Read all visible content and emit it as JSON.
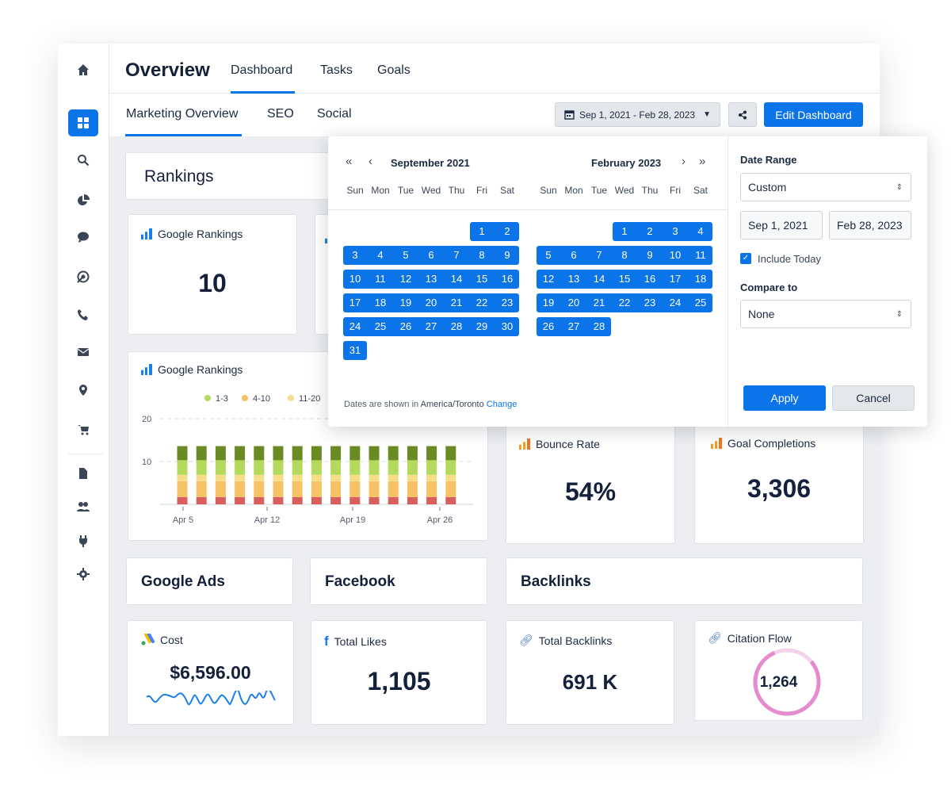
{
  "colors": {
    "accent": "#0a74e8",
    "bg": "#eceef2",
    "red": "#d95f5f",
    "orange": "#f7c266",
    "yellow": "#f5dd8a",
    "lightgreen": "#b5d95c",
    "darkgreen": "#6a8a24",
    "citation": "#e48ccf"
  },
  "sidebar": {
    "items": [
      "home-icon",
      "dashboard-icon",
      "search-icon",
      "pie-chart-icon",
      "chat-icon",
      "target-icon",
      "phone-icon",
      "mail-icon",
      "location-icon",
      "cart-icon",
      "document-icon",
      "users-icon",
      "plug-icon",
      "gear-icon"
    ],
    "active": "dashboard-icon"
  },
  "header": {
    "title": "Overview",
    "tabs": [
      "Dashboard",
      "Tasks",
      "Goals"
    ],
    "active_tab": "Dashboard"
  },
  "subnav": {
    "tabs": [
      "Marketing Overview",
      "SEO",
      "Social"
    ],
    "active_tab": "Marketing Overview",
    "date_range": "Sep 1, 2021 - Feb 28, 2023",
    "edit_label": "Edit Dashboard"
  },
  "datepicker": {
    "left_month": "September 2021",
    "right_month": "February 2023",
    "weekdays": [
      "Sun",
      "Mon",
      "Tue",
      "Wed",
      "Thu",
      "Fri",
      "Sat"
    ],
    "left_offset": 5,
    "left_days": 30,
    "left_last": 31,
    "right_offset": 3,
    "right_days": 28,
    "footer_text": "Dates are shown in",
    "timezone": "America/Toronto",
    "change_link": "Change",
    "date_range_label": "Date Range",
    "date_range_value": "Custom",
    "start": "Sep 1, 2021",
    "end": "Feb 28, 2023",
    "include_today": "Include Today",
    "include_today_checked": true,
    "compare_label": "Compare to",
    "compare_value": "None",
    "apply": "Apply",
    "cancel": "Cancel"
  },
  "sections": {
    "rankings": "Rankings",
    "google_ads": "Google Ads",
    "facebook": "Facebook",
    "backlinks": "Backlinks"
  },
  "cards": {
    "google_rankings": {
      "title": "Google Rankings",
      "value": "10"
    },
    "bounce": {
      "title": "Bounce Rate",
      "value": "54%"
    },
    "goals": {
      "title": "Goal Completions",
      "value": "3,306"
    },
    "cost": {
      "title": "Cost",
      "value": "$6,596.00"
    },
    "likes": {
      "title": "Total Likes",
      "value": "1,105"
    },
    "total_backlinks": {
      "title": "Total Backlinks",
      "value": "691 K"
    },
    "citation": {
      "title": "Citation Flow",
      "value": "1,264"
    }
  },
  "chart_data": {
    "type": "bar",
    "stacked": true,
    "title": "Google Rankings",
    "ylim": [
      0,
      20
    ],
    "yticks": [
      "10",
      "20"
    ],
    "grid": true,
    "xticks": [
      "Apr 5",
      "Apr 12",
      "Apr 19",
      "Apr 26"
    ],
    "legend": [
      "1-3",
      "4-10",
      "11-20"
    ],
    "bar_count": 15,
    "series": [
      {
        "color": "#d95f5f",
        "values": [
          1.7,
          1.7,
          1.7,
          1.7,
          1.7,
          1.7,
          1.7,
          1.7,
          1.7,
          1.7,
          1.7,
          1.7,
          1.7,
          1.7,
          1.7
        ]
      },
      {
        "name": "4-10",
        "color": "#f7c266",
        "values": [
          3.7,
          3.7,
          3.7,
          3.7,
          3.7,
          3.7,
          3.7,
          3.7,
          3.7,
          3.7,
          3.7,
          3.7,
          3.7,
          3.7,
          3.7
        ]
      },
      {
        "name": "11-20",
        "color": "#f5dd8a",
        "values": [
          1.5,
          1.5,
          1.5,
          1.5,
          1.5,
          1.5,
          1.5,
          1.5,
          1.5,
          1.5,
          1.5,
          1.5,
          1.5,
          1.5,
          1.5
        ]
      },
      {
        "name": "1-3",
        "color": "#b5d95c",
        "values": [
          3.4,
          3.4,
          3.4,
          3.4,
          3.4,
          3.4,
          3.4,
          3.4,
          3.4,
          3.4,
          3.4,
          3.4,
          3.4,
          3.4,
          3.4
        ]
      },
      {
        "color": "#6a8a24",
        "values": [
          3.3,
          3.3,
          3.3,
          3.3,
          3.3,
          3.3,
          3.3,
          3.3,
          3.3,
          3.3,
          3.3,
          3.3,
          3.3,
          3.3,
          3.3
        ]
      }
    ]
  }
}
